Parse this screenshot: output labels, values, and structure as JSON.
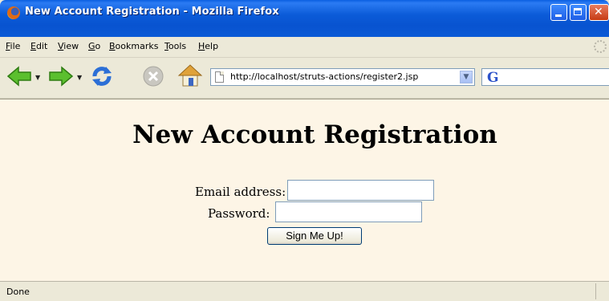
{
  "window": {
    "title": "New Account Registration - Mozilla Firefox"
  },
  "menu": {
    "items": [
      {
        "accel": "F",
        "rest": "ile"
      },
      {
        "accel": "E",
        "rest": "dit"
      },
      {
        "accel": "V",
        "rest": "iew"
      },
      {
        "accel": "G",
        "rest": "o"
      },
      {
        "accel": "B",
        "rest": "ookmarks"
      },
      {
        "accel": "T",
        "rest": "ools"
      },
      {
        "accel": "H",
        "rest": "elp"
      }
    ]
  },
  "toolbar": {
    "url": "http://localhost/struts-actions/register2.jsp",
    "icons": [
      "back-icon",
      "forward-icon",
      "reload-icon",
      "stop-icon",
      "home-icon",
      "page-icon",
      "google-icon"
    ]
  },
  "page": {
    "heading": "New Account Registration",
    "email_label": "Email address:",
    "password_label": "Password:",
    "email_value": "",
    "password_value": "",
    "submit_label": "Sign Me Up!",
    "background": "#fdf5e6"
  },
  "status": {
    "text": "Done"
  }
}
